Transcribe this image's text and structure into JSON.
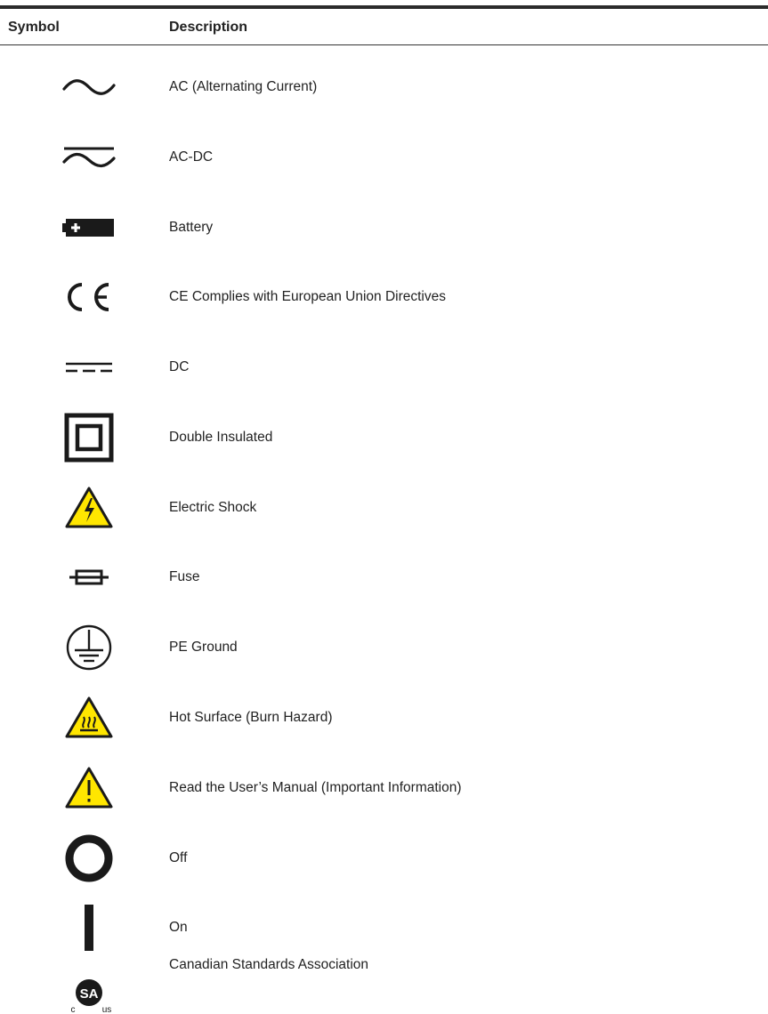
{
  "table": {
    "headers": {
      "symbol": "Symbol",
      "description": "Description"
    },
    "rows": [
      {
        "icon": "ac-sine-icon",
        "description": "AC (Alternating Current)"
      },
      {
        "icon": "ac-dc-icon",
        "description": "AC-DC"
      },
      {
        "icon": "battery-icon",
        "description": "Battery"
      },
      {
        "icon": "ce-mark-icon",
        "description": "CE Complies with European Union Directives"
      },
      {
        "icon": "dc-icon",
        "description": "DC"
      },
      {
        "icon": "double-insulated-icon",
        "description": "Double Insulated"
      },
      {
        "icon": "electric-shock-warning-icon",
        "description": "Electric Shock"
      },
      {
        "icon": "fuse-icon",
        "description": "Fuse"
      },
      {
        "icon": "pe-ground-icon",
        "description": "PE Ground"
      },
      {
        "icon": "hot-surface-warning-icon",
        "description": "Hot Surface (Burn Hazard)"
      },
      {
        "icon": "caution-warning-icon",
        "description": "Read the User’s Manual (Important Information)"
      },
      {
        "icon": "power-off-icon",
        "description": "Off"
      },
      {
        "icon": "power-on-icon",
        "description": "On"
      },
      {
        "icon": "csa-mark-icon",
        "description": "Canadian Standards Association",
        "mark_text": [
          "c",
          "us"
        ]
      }
    ]
  },
  "colors": {
    "warning_yellow": "#ffe600",
    "ink": "#1a1a1a"
  }
}
